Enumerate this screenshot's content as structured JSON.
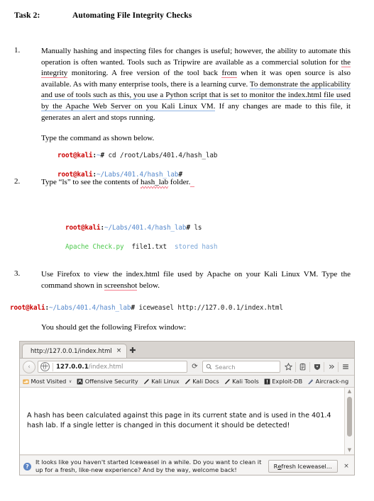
{
  "document": {
    "task_label": "Task 2:",
    "task_title": "Automating File Integrity Checks",
    "steps": [
      {
        "number": "1.",
        "text_parts": [
          "Manually hashing and inspecting files for changes is useful; however, the ability to automate this operation is often wanted. Tools such as Tripwire are available as a commercial solution for ",
          "the integrity",
          " monitoring. A free version of the tool back ",
          "from",
          " when it was open source is also available. As with many enterprise tools, there is a learning curve. ",
          "To demonstrate the applicability and use of tools such as this, you use a Python script that is set to monitor the index.html file used by the Apache Web Server on ",
          "you",
          " Kali Linux VM.",
          " If any changes are made to this file, it generates an alert and stops running."
        ],
        "follow_up": "Type the command as shown below."
      },
      {
        "number": "2.",
        "text_before": "Type “ls” to see the contents of ",
        "misspelled": "hash_lab",
        "text_after": " folder."
      },
      {
        "number": "3.",
        "text_before": "Use Firefox to view the index.html file used by Apache on your Kali Linux VM. Type the command shown in ",
        "misspelled": "screenshot",
        "text_after": " below."
      }
    ],
    "caption": "You should get the following Firefox window:"
  },
  "terminal1": {
    "line1": {
      "user": "root@kali",
      "colon": ":",
      "path": "~",
      "hash": "# ",
      "command": "cd /root/Labs/401.4/hash_lab"
    },
    "line2": {
      "user": "root@kali",
      "colon": ":",
      "path": "~/Labs/401.4/hash_lab",
      "hash": "#",
      "command": ""
    }
  },
  "terminal2": {
    "line1": {
      "user": "root@kali",
      "colon": ":",
      "path": "~/Labs/401.4/hash_lab",
      "hash": "# ",
      "command": "ls"
    },
    "output": {
      "green": "Apache Check.py",
      "black": "file1.txt",
      "blue": "stored hash"
    }
  },
  "terminal3": {
    "line1": {
      "user": "root@kali",
      "colon": ":",
      "path": "~/Labs/401.4/hash_lab",
      "hash": "# ",
      "command": "iceweasel http://127.0.0.1/index.html"
    }
  },
  "browser": {
    "tab": {
      "title": "http://127.0.0.1/index.html",
      "close": "×"
    },
    "new_tab": "✚",
    "nav": {
      "back": "‹",
      "url_bold": "127.0.0.1",
      "url_rest": "/index.html",
      "reload": "⟳",
      "search_placeholder": "Search"
    },
    "bookmarks": [
      {
        "label": "Most Visited",
        "icon": "folder-icon",
        "caret": "∨"
      },
      {
        "label": "Offensive Security",
        "icon": "offensive-security-icon"
      },
      {
        "label": "Kali Linux",
        "icon": "kali-dragon-icon"
      },
      {
        "label": "Kali Docs",
        "icon": "kali-dragon-icon"
      },
      {
        "label": "Kali Tools",
        "icon": "kali-dragon-icon"
      },
      {
        "label": "Exploit-DB",
        "icon": "exploit-db-icon"
      },
      {
        "label": "Aircrack-ng",
        "icon": "aircrack-icon"
      }
    ],
    "page_content": "A hash has been calculated against this page in its current state and is used in the 401.4 hash lab. If a single letter is changed in this document it should be detected!",
    "notification": {
      "icon_glyph": "?",
      "message": "It looks like you haven't started Iceweasel in a while. Do you want to clean it up for a fresh, like-new experience? And by the way, welcome back!",
      "button_prefix": "R",
      "button_underline": "e",
      "button_suffix": "fresh Iceweasel…",
      "close": "×"
    }
  },
  "colors": {
    "prompt_user": "#cc0000",
    "prompt_path": "#5588cc",
    "output_green": "#4ec94e",
    "output_blue": "#7aa6d8",
    "spell_underline": "#f4808f",
    "grammar_underline": "#8fb4e3"
  }
}
